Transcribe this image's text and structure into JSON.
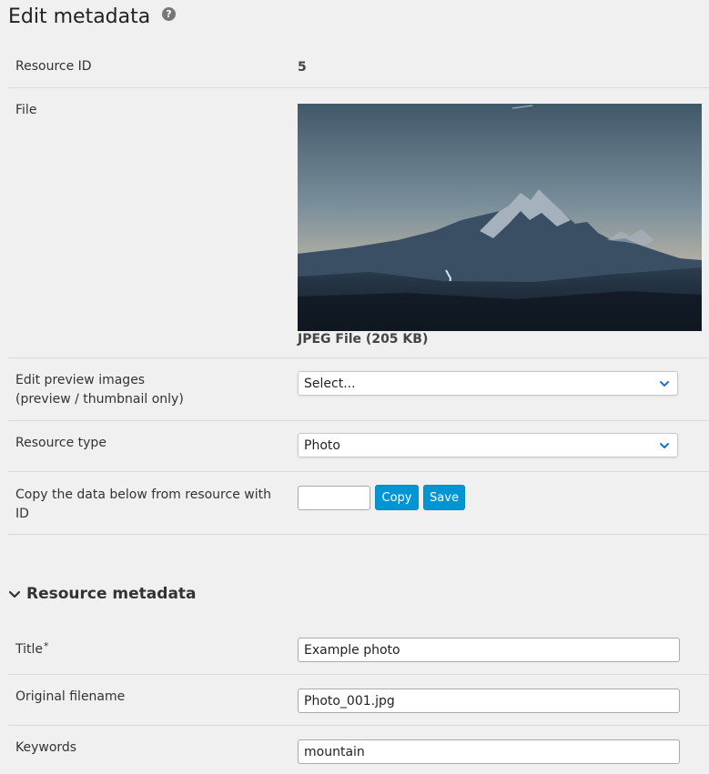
{
  "header": {
    "title": "Edit metadata",
    "help_icon": "question-circle-icon"
  },
  "fields": {
    "resource_id": {
      "label": "Resource ID",
      "value": "5"
    },
    "file": {
      "label": "File",
      "info": "JPEG File (205 KB)"
    },
    "edit_preview": {
      "label_line1": "Edit preview images",
      "label_line2": "(preview / thumbnail only)",
      "selected": "Select..."
    },
    "resource_type": {
      "label": "Resource type",
      "selected": "Photo"
    },
    "copy_from": {
      "label_line1": "Copy the data below from resource with",
      "label_line2": "ID",
      "value": "",
      "copy_label": "Copy",
      "save_label": "Save"
    }
  },
  "metadata_section": {
    "title": "Resource metadata",
    "expanded": true,
    "fields": {
      "title": {
        "label": "Title",
        "required_mark": "*",
        "value": "Example photo"
      },
      "original_filename": {
        "label": "Original filename",
        "value": "Photo_001.jpg"
      },
      "keywords": {
        "label": "Keywords",
        "value": "mountain"
      }
    }
  },
  "colors": {
    "background": "#f0f0f0",
    "button": "#0096d6",
    "divider": "#d9d9d9",
    "accent_chevron": "#1a73c8"
  }
}
